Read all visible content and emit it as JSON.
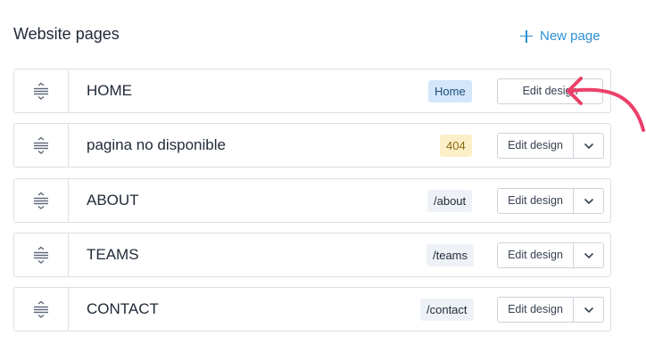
{
  "header": {
    "title": "Website pages",
    "new_page_label": "New page",
    "new_page_icon": "plus-icon"
  },
  "colors": {
    "accent": "#2d8fd5",
    "annotation_arrow": "#ec3f6a",
    "home_badge_bg": "#d3e6fa",
    "home_badge_text": "#1d4e7a",
    "error_badge_bg": "#fcefc8",
    "error_badge_text": "#8a6a12",
    "path_badge_bg": "#eef2f7"
  },
  "pages": [
    {
      "name": "HOME",
      "badge": "Home",
      "badge_type": "home",
      "edit_label": "Edit design",
      "has_dropdown": false
    },
    {
      "name": "pagina no disponible",
      "badge": "404",
      "badge_type": "error",
      "edit_label": "Edit design",
      "has_dropdown": true
    },
    {
      "name": "ABOUT",
      "badge": "/about",
      "badge_type": "path",
      "edit_label": "Edit design",
      "has_dropdown": true
    },
    {
      "name": "TEAMS",
      "badge": "/teams",
      "badge_type": "path",
      "edit_label": "Edit design",
      "has_dropdown": true
    },
    {
      "name": "CONTACT",
      "badge": "/contact",
      "badge_type": "path",
      "edit_label": "Edit design",
      "has_dropdown": true
    }
  ]
}
